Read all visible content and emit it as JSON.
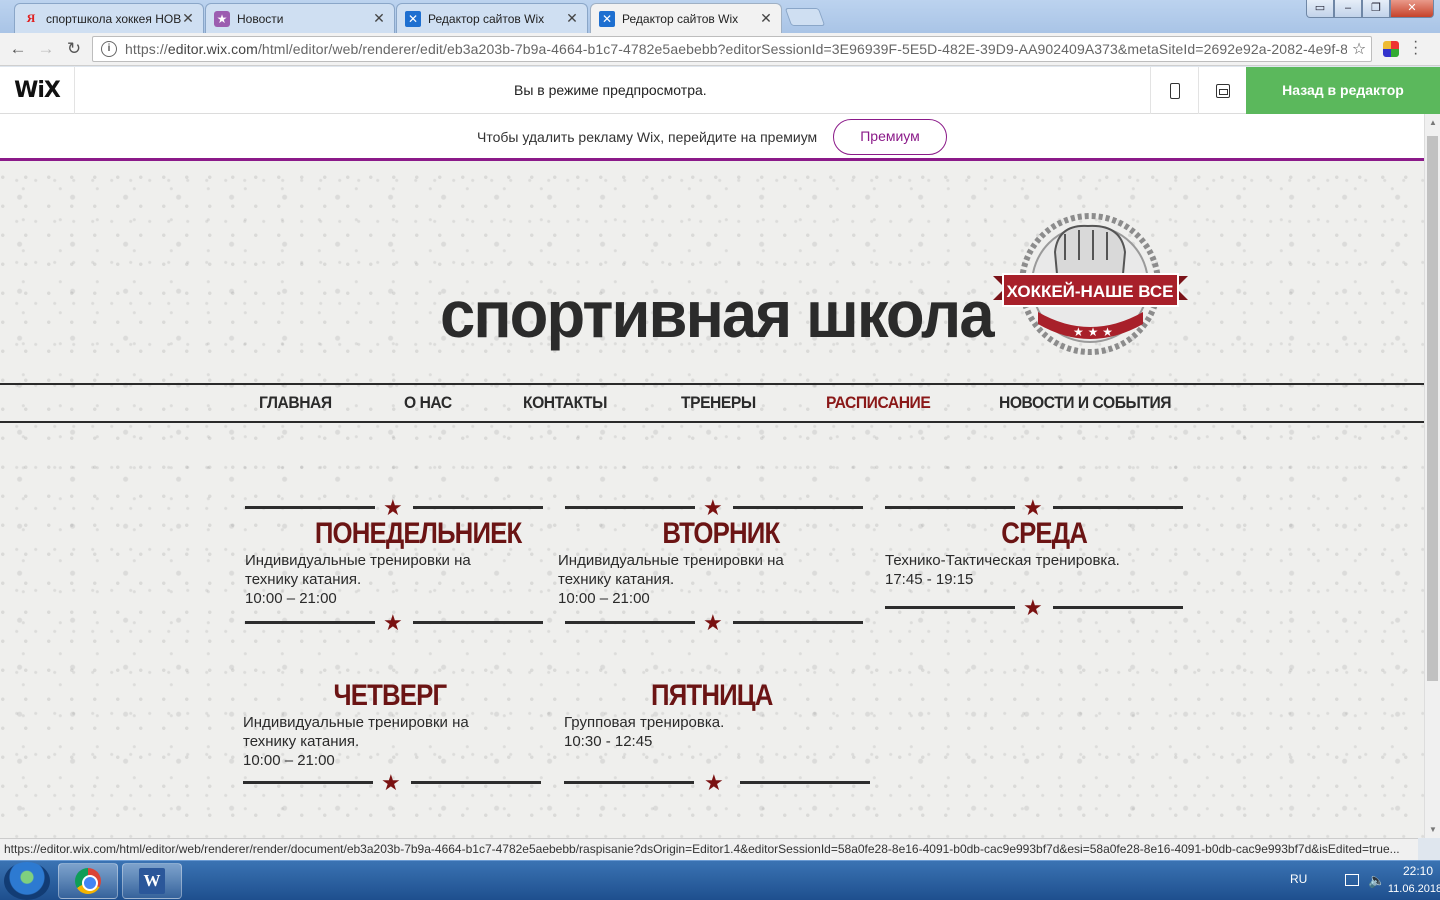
{
  "browser": {
    "tabs": [
      {
        "label": "спортшкола хоккея НОВ",
        "icon": "yandex-icon",
        "active": false
      },
      {
        "label": "Новости",
        "icon": "news-icon",
        "active": false
      },
      {
        "label": "Редактор сайтов Wix",
        "icon": "wix-icon",
        "active": false
      },
      {
        "label": "Редактор сайтов Wix",
        "icon": "wix-icon",
        "active": true
      }
    ],
    "url_prefix": "https://",
    "url_host": "editor.wix.com",
    "url_path": "/html/editor/web/renderer/edit/eb3a203b-7b9a-4664-b1c7-4782e5aebebb?editorSessionId=3E96939F-5E5D-482E-39D9-AA902409A373&metaSiteId=2692e92a-2082-4e9f-8...",
    "status_url": "https://editor.wix.com/html/editor/web/renderer/render/document/eb3a203b-7b9a-4664-b1c7-4782e5aebebb/raspisanie?dsOrigin=Editor1.4&editorSessionId=58a0fe28-8e16-4091-b0db-cac9e993bf7d&esi=58a0fe28-8e16-4091-b0db-cac9e993bf7d&isEdited=true..."
  },
  "wixbar": {
    "logo": "WiX",
    "preview_message": "Вы в режиме предпросмотра.",
    "back_button": "Назад в редактор"
  },
  "promo": {
    "text": "Чтобы удалить рекламу Wix, перейдите на премиум",
    "button": "Премиум"
  },
  "site": {
    "title": "спортивная школа",
    "emblem_text": "ХОККЕЙ-НАШЕ ВСЕ",
    "nav": [
      "ГЛАВНАЯ",
      "О НАС",
      "КОНТАКТЫ",
      "ТРЕНЕРЫ",
      "РАСПИСАНИЕ",
      "НОВОСТИ И СОБЫТИЯ"
    ],
    "active_nav": "РАСПИСАНИЕ",
    "schedule": [
      {
        "day": "ПОНЕДЕЛЬНИЕК",
        "line1": "Индивидуальные тренировки на",
        "line2": "технику катания.",
        "line3": "10:00 – 21:00"
      },
      {
        "day": "ВТОРНИК",
        "line1": "Индивидуальные тренировки на",
        "line2": "технику катания.",
        "line3": "10:00 – 21:00"
      },
      {
        "day": "СРЕДА",
        "line1": "Технико-Тактическая тренировка.",
        "line2": "17:45 - 19:15",
        "line3": ""
      },
      {
        "day": "ЧЕТВЕРГ",
        "line1": "Индивидуальные тренировки на",
        "line2": "технику катания.",
        "line3": "10:00 – 21:00"
      },
      {
        "day": "ПЯТНИЦА",
        "line1": "Групповая тренировка.",
        "line2": "10:30 - 12:45",
        "line3": ""
      }
    ]
  },
  "colors": {
    "accent_green": "#5bb85c",
    "premium_purple": "#8b1a89",
    "day_red": "#6b1414",
    "active_nav_red": "#8a1818"
  },
  "taskbar": {
    "lang": "RU",
    "time": "22:10",
    "date": "11.06.2018"
  }
}
